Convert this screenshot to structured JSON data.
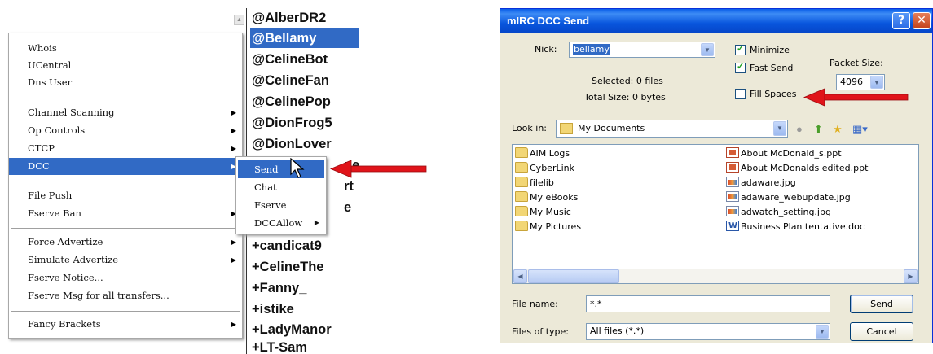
{
  "context_menu": {
    "items": [
      "Whois",
      "UCentral",
      "Dns User",
      "Channel Scanning",
      "Op Controls",
      "CTCP",
      "DCC",
      "File Push",
      "Fserve Ban",
      "Force Advertize",
      "Simulate Advertize",
      "Fserve Notice...",
      "Fserve Msg for all transfers...",
      "Fancy Brackets"
    ],
    "selected": "DCC"
  },
  "dcc_submenu": {
    "items": [
      "Send",
      "Chat",
      "Fserve",
      "DCCAllow"
    ],
    "selected": "Send"
  },
  "nicklist": {
    "nicks": [
      "@AlberDR2",
      "@Bellamy",
      "@CelineBot",
      "@CelineFan",
      "@CelinePop",
      "@DionFrog5",
      "@DionLover",
      "",
      "",
      "",
      "",
      "+candicat9",
      "+CelineThe",
      "+Fanny_",
      "+istike",
      "+LadyManor",
      "+LT-Sam"
    ],
    "partial_fragments": [
      "ne",
      "rt",
      "e"
    ],
    "selected": "@Bellamy"
  },
  "dialog": {
    "title": "mIRC DCC Send",
    "help_glyph": "?",
    "close_glyph": "✕",
    "nick_label": "Nick:",
    "nick_value": "bellamy",
    "selected_files": "Selected: 0 files",
    "total_size": "Total Size: 0 bytes",
    "minimize_label": "Minimize",
    "minimize_checked": true,
    "fast_send_label": "Fast Send",
    "fast_send_checked": true,
    "fill_spaces_label": "Fill Spaces",
    "fill_spaces_checked": false,
    "packet_size_label": "Packet Size:",
    "packet_size_value": "4096",
    "look_in_label": "Look in:",
    "look_in_value": "My Documents",
    "folders": [
      "AIM Logs",
      "CyberLink",
      "filelib",
      "My eBooks",
      "My Music",
      "My Pictures"
    ],
    "files": [
      {
        "name": "About McDonald_s.ppt",
        "icon": "ppt-icon"
      },
      {
        "name": "About McDonalds edited.ppt",
        "icon": "ppt-icon"
      },
      {
        "name": "adaware.jpg",
        "icon": "jpg-icon"
      },
      {
        "name": "adaware_webupdate.jpg",
        "icon": "jpg-icon"
      },
      {
        "name": "adwatch_setting.jpg",
        "icon": "jpg-icon"
      },
      {
        "name": "Business Plan tentative.doc",
        "icon": "doc-icon"
      }
    ],
    "file_name_label": "File name:",
    "file_name_value": "*.*",
    "files_of_type_label": "Files of type:",
    "files_of_type_value": "All files (*.*)",
    "send_button": "Send",
    "cancel_button": "Cancel"
  },
  "colors": {
    "selection": "#316ac5",
    "arrow_red": "#e0141a",
    "dialog_bg": "#ece9d8",
    "titlebar": "#0a5ee8"
  }
}
